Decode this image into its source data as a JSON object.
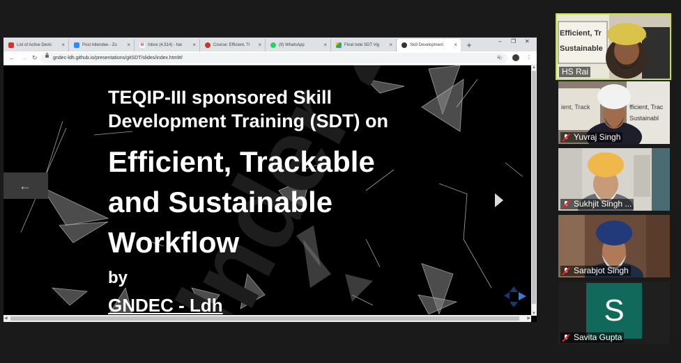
{
  "browser": {
    "tabs": [
      {
        "label": "List of Active Devic",
        "icon": "pdf-icon",
        "color": "#d93025"
      },
      {
        "label": "Post Attendee - Zo",
        "icon": "zoom-icon",
        "color": "#2d8cff"
      },
      {
        "label": "Inbox (4,514) - har",
        "icon": "gmail-icon",
        "color": "#ea4335"
      },
      {
        "label": "Course: Efficient, Tr",
        "icon": "course-icon",
        "color": "#c0392b"
      },
      {
        "label": "(9) WhatsApp",
        "icon": "whatsapp-icon",
        "color": "#25d366"
      },
      {
        "label": "Final note SDT Vig",
        "icon": "drive-icon",
        "color": "#34a853"
      },
      {
        "label": "Skill Development",
        "icon": "github-icon",
        "color": "#333333"
      }
    ],
    "new_tab": "+",
    "url": "gndec-ldh.github.io/presentations/gitSDT/slides/index.html#/"
  },
  "slide": {
    "line1": "TEQIP-III sponsored Skill",
    "line2": "Development Training (SDT) on",
    "title1": "Efficient, Trackable",
    "title2": "and Sustainable",
    "title3": "Workflow",
    "by": "by",
    "org": "GNDEC - Ldh",
    "watermark": "Inder 23",
    "prev_glyph": "←"
  },
  "participants": [
    {
      "name": "HS Rai",
      "muted": false,
      "active": true
    },
    {
      "name": "Yuvraj Singh",
      "muted": true
    },
    {
      "name": "Sukhjit Singh ...",
      "muted": true
    },
    {
      "name": "Sarabjot Singh",
      "muted": true
    },
    {
      "name": "Savita Gupta",
      "muted": true,
      "avatar_letter": "S",
      "avatar_color": "#10695a"
    }
  ],
  "colors": {
    "active_speaker_border": "#c7e235",
    "mute_red": "#e02828"
  }
}
